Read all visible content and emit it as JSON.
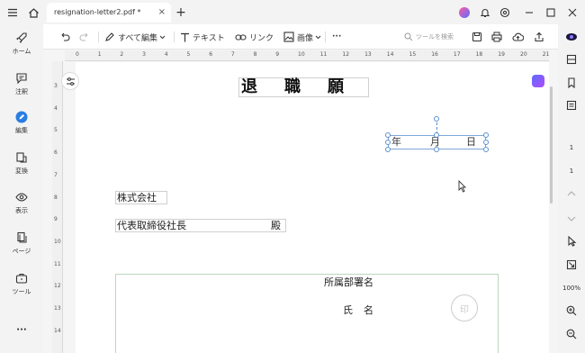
{
  "titlebar": {
    "tab_title": "resignation-letter2.pdf *",
    "tab_close": "×",
    "new_tab": "+"
  },
  "toolbar": {
    "edit_all_label": "すべて編集",
    "text_label": "テキスト",
    "link_label": "リンク",
    "image_label": "画像",
    "more_label": "···",
    "search_placeholder": "ツールを検索"
  },
  "leftbar": {
    "items": [
      {
        "label": "ホーム",
        "icon": "rocket-icon"
      },
      {
        "label": "注釈",
        "icon": "comment-icon"
      },
      {
        "label": "編集",
        "icon": "edit-icon"
      },
      {
        "label": "変換",
        "icon": "convert-icon"
      },
      {
        "label": "表示",
        "icon": "eye-icon"
      },
      {
        "label": "ページ",
        "icon": "pages-icon"
      },
      {
        "label": "ツール",
        "icon": "toolbox-icon"
      }
    ],
    "more_label": "···"
  },
  "rightbar": {
    "page_current": "1",
    "page_total": "1",
    "zoom": "100%"
  },
  "ruler": {
    "h": [
      "0",
      "1",
      "2",
      "3",
      "4",
      "5",
      "6",
      "7",
      "8",
      "9",
      "10",
      "11",
      "12",
      "13",
      "14",
      "15",
      "16",
      "17",
      "18",
      "19",
      "20",
      "21"
    ],
    "v": [
      "3",
      "4",
      "5",
      "6",
      "7",
      "8",
      "9",
      "10",
      "11",
      "12",
      "13",
      "14"
    ]
  },
  "document": {
    "title": "退職願",
    "date_year": "年",
    "date_month": "月",
    "date_day": "日",
    "company": "株式会社",
    "president": "代表取締役社長",
    "honorific": "殿",
    "dept_sign": "所属部署名",
    "name_sign": "氏名",
    "seal": "印"
  },
  "colors": {
    "selection": "#5b8fd0",
    "accent": "#6b4bff"
  }
}
